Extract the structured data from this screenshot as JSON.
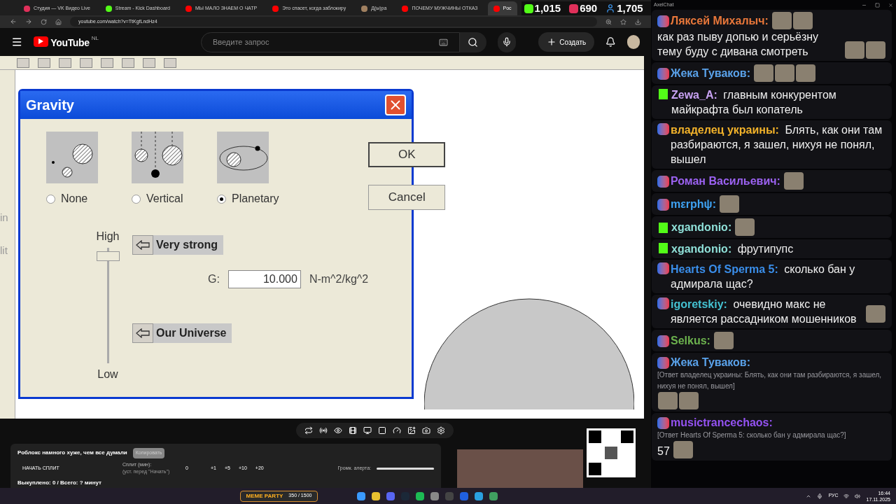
{
  "browser": {
    "tabs": [
      {
        "kind": "vk",
        "label": "Студия — VK Видео Live",
        "selected": false
      },
      {
        "kind": "kick",
        "label": "Stream - Kick Dashboard",
        "selected": false
      },
      {
        "kind": "youtube",
        "label": "МЫ МАЛО ЗНАЕМ О ЧАТР",
        "selected": false
      },
      {
        "kind": "youtube",
        "label": "Это спасет, когда заблокиру",
        "selected": false
      },
      {
        "kind": "other",
        "label": "Д(ы)ра",
        "selected": false
      },
      {
        "kind": "youtube",
        "label": "ПОЧЕМУ МУЖЧИНЫ ОТКАЗ",
        "selected": false
      },
      {
        "kind": "youtube",
        "label": "Poc",
        "selected": true
      }
    ],
    "stats": [
      {
        "kind": "kick",
        "value": "1,015"
      },
      {
        "kind": "live",
        "value": "690"
      },
      {
        "kind": "viewers",
        "value": "1,705"
      }
    ],
    "address": "youtube.com/watch?v=TtKgfLndHz4",
    "youtube": {
      "logo": "YouTube",
      "region": "NL",
      "search_placeholder": "Введите запрос",
      "create": "Создать"
    }
  },
  "app": {
    "side_fragments": [
      "in",
      "lit"
    ],
    "dialog": {
      "title": "Gravity",
      "options": [
        {
          "kind": "none",
          "label": "None",
          "selected": false
        },
        {
          "kind": "vertical",
          "label": "Vertical",
          "selected": false
        },
        {
          "kind": "planetary",
          "label": "Planetary",
          "selected": true
        }
      ],
      "ok": "OK",
      "cancel": "Cancel",
      "slider": {
        "high": "High",
        "low": "Low",
        "level": 0.97
      },
      "presets": [
        "Very strong",
        "Our Universe"
      ],
      "g_label": "G:",
      "g_value": "10.000",
      "g_unit": "N-m^2/kg^2"
    }
  },
  "stream_panel": {
    "title": "Роблокс намного хуже, чем все думали",
    "copy_button": {
      "label": "Копировать",
      "disabled": true
    },
    "split_button": "НАЧАТЬ СПЛИТ",
    "split_label": "Сплит (мин):",
    "split_hint": "(уст. перед \"Начать\")",
    "split_value": "0",
    "increments": [
      "+1",
      "+5",
      "+10",
      "+20"
    ],
    "alert": {
      "label": "Громк. алерта:",
      "level": 1.0
    },
    "summary": "Выкуплено: 0 / Всего: ? минут"
  },
  "widget": {
    "title": "MEME PARTY",
    "count": "350 / 1500"
  },
  "chat": {
    "title": "AxelChat",
    "messages": [
      {
        "kind": "live",
        "author": "Ляксей Михалыч:",
        "color": "#e8773a",
        "parts": [
          {
            "kind": "emote"
          },
          {
            "kind": "emote"
          },
          {
            "kind": "text",
            "text": "как раз пыву допью и серьёзну тему буду с дивана смотреть"
          },
          {
            "kind": "emote"
          },
          {
            "kind": "emote"
          }
        ]
      },
      {
        "kind": "live",
        "author": "Жека Туваков:",
        "color": "#5aa2ea",
        "parts": [
          {
            "kind": "emote"
          },
          {
            "kind": "emote"
          },
          {
            "kind": "emote"
          }
        ]
      },
      {
        "kind": "kick",
        "author": "Zewa_A:",
        "color": "#c8a2f2",
        "parts": [
          {
            "kind": "text",
            "text": "главным конкурентом майкрафта был копатель"
          }
        ]
      },
      {
        "kind": "live",
        "author": "владелец украины:",
        "color": "#f2b22a",
        "parts": [
          {
            "kind": "text",
            "text": "Блять, как они там разбираются, я зашел, нихуя не понял, вышел"
          }
        ]
      },
      {
        "kind": "live",
        "author": "Роман Васильевич:",
        "color": "#9c62f2",
        "parts": [
          {
            "kind": "emote"
          }
        ]
      },
      {
        "kind": "live",
        "author": "mεrphψ:",
        "color": "#3ea2f2",
        "parts": [
          {
            "kind": "emote"
          }
        ]
      },
      {
        "kind": "kick",
        "author": "xgandonio:",
        "color": "#8fe0d8",
        "parts": [
          {
            "kind": "emote"
          }
        ]
      },
      {
        "kind": "kick",
        "author": "xgandonio:",
        "color": "#8fe0d8",
        "parts": [
          {
            "kind": "text",
            "text": "фрутипупс"
          }
        ]
      },
      {
        "kind": "live",
        "author": "Hearts Of Sperma 5:",
        "color": "#3a8eea",
        "parts": [
          {
            "kind": "text",
            "text": "сколько бан у адмирала щас?"
          }
        ]
      },
      {
        "kind": "live",
        "author": "igoretskiy:",
        "color": "#44c2d2",
        "parts": [
          {
            "kind": "text",
            "text": "очевидно макс не является рассадником мошенников"
          },
          {
            "kind": "emote"
          }
        ]
      },
      {
        "kind": "live",
        "author": "Selkus:",
        "color": "#6cb24e",
        "parts": [
          {
            "kind": "emote"
          }
        ]
      },
      {
        "kind": "live",
        "author": "Жека Туваков:",
        "color": "#5aa2ea",
        "reply": "[Ответ владелец украины: Блять, как они там разбираются, я зашел, нихуя не понял, вышел]",
        "parts": [
          {
            "kind": "emote"
          },
          {
            "kind": "emote"
          }
        ]
      },
      {
        "kind": "live",
        "author": "musictrancechaos:",
        "color": "#9452f2",
        "reply": "[Ответ Hearts Of Sperma 5: сколько бан у адмирала щас?]",
        "parts": [
          {
            "kind": "text",
            "text": "57"
          },
          {
            "kind": "emote"
          }
        ]
      }
    ]
  },
  "taskbar": {
    "language": "РУС",
    "time": "16:44",
    "date": "17.11.2025"
  }
}
